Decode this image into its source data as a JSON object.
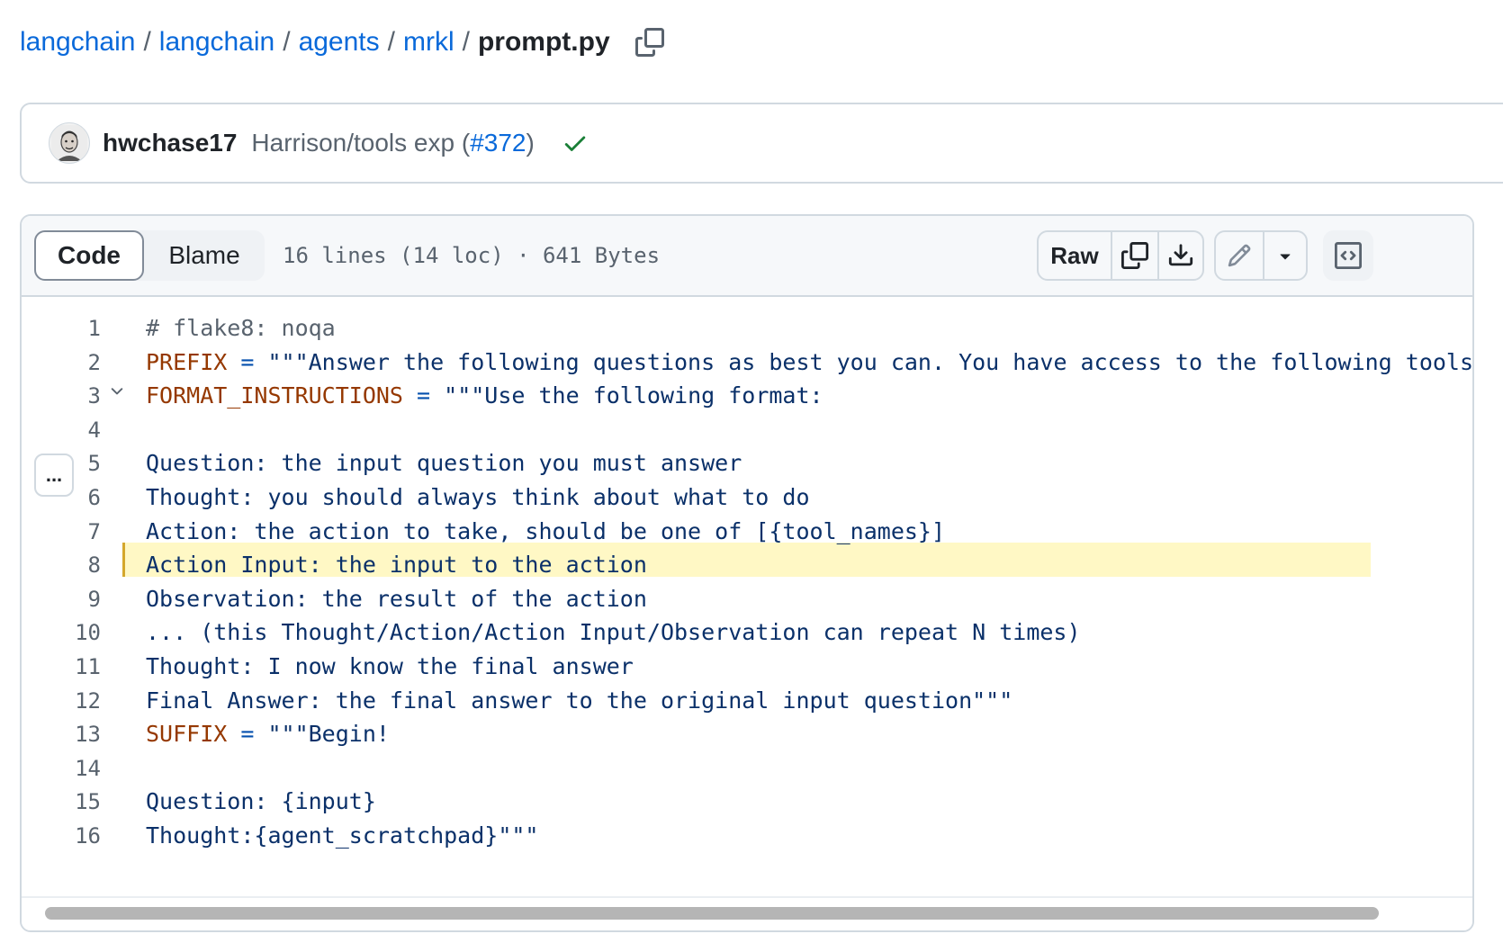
{
  "breadcrumb": {
    "items": [
      "langchain",
      "langchain",
      "agents",
      "mrkl"
    ],
    "separator": "/",
    "file": "prompt.py"
  },
  "commit": {
    "author": "hwchase17",
    "message": "Harrison/tools exp (",
    "pr": "#372",
    "message_end": ")",
    "status": "check-icon"
  },
  "file_header": {
    "tabs": [
      "Code",
      "Blame"
    ],
    "active_tab": "Code",
    "meta": "16 lines (14 loc) · 641 Bytes",
    "raw_label": "Raw",
    "more_label": "..."
  },
  "code": {
    "lines": [
      {
        "num": "1",
        "name": "",
        "op": "",
        "text": "# flake8: noqa",
        "comment": true
      },
      {
        "num": "2",
        "name": "PREFIX",
        "op": " = ",
        "text": "\"\"\"Answer the following questions as best you can. You have access to the following tools:\"\"\""
      },
      {
        "num": "3",
        "name": "FORMAT_INSTRUCTIONS",
        "op": " = ",
        "text": "\"\"\"Use the following format:"
      },
      {
        "num": "4",
        "name": "",
        "op": "",
        "text": ""
      },
      {
        "num": "5",
        "name": "",
        "op": "",
        "text": "Question: the input question you must answer"
      },
      {
        "num": "6",
        "name": "",
        "op": "",
        "text": "Thought: you should always think about what to do"
      },
      {
        "num": "7",
        "name": "",
        "op": "",
        "text": "Action: the action to take, should be one of [{tool_names}]"
      },
      {
        "num": "8",
        "name": "",
        "op": "",
        "text": "Action Input: the input to the action"
      },
      {
        "num": "9",
        "name": "",
        "op": "",
        "text": "Observation: the result of the action"
      },
      {
        "num": "10",
        "name": "",
        "op": "",
        "text": "... (this Thought/Action/Action Input/Observation can repeat N times)"
      },
      {
        "num": "11",
        "name": "",
        "op": "",
        "text": "Thought: I now know the final answer"
      },
      {
        "num": "12",
        "name": "",
        "op": "",
        "text": "Final Answer: the final answer to the original input question\"\"\""
      },
      {
        "num": "13",
        "name": "SUFFIX",
        "op": " = ",
        "text": "\"\"\"Begin!"
      },
      {
        "num": "14",
        "name": "",
        "op": "",
        "text": ""
      },
      {
        "num": "15",
        "name": "",
        "op": "",
        "text": "Question: {input}"
      },
      {
        "num": "16",
        "name": "",
        "op": "",
        "text": "Thought:{agent_scratchpad}\"\"\""
      }
    ],
    "highlighted_line": "6"
  },
  "colors": {
    "link": "#0969da",
    "string": "#0a3069",
    "name": "#953800",
    "highlight": "#fff8c5",
    "success": "#1a7f37"
  }
}
